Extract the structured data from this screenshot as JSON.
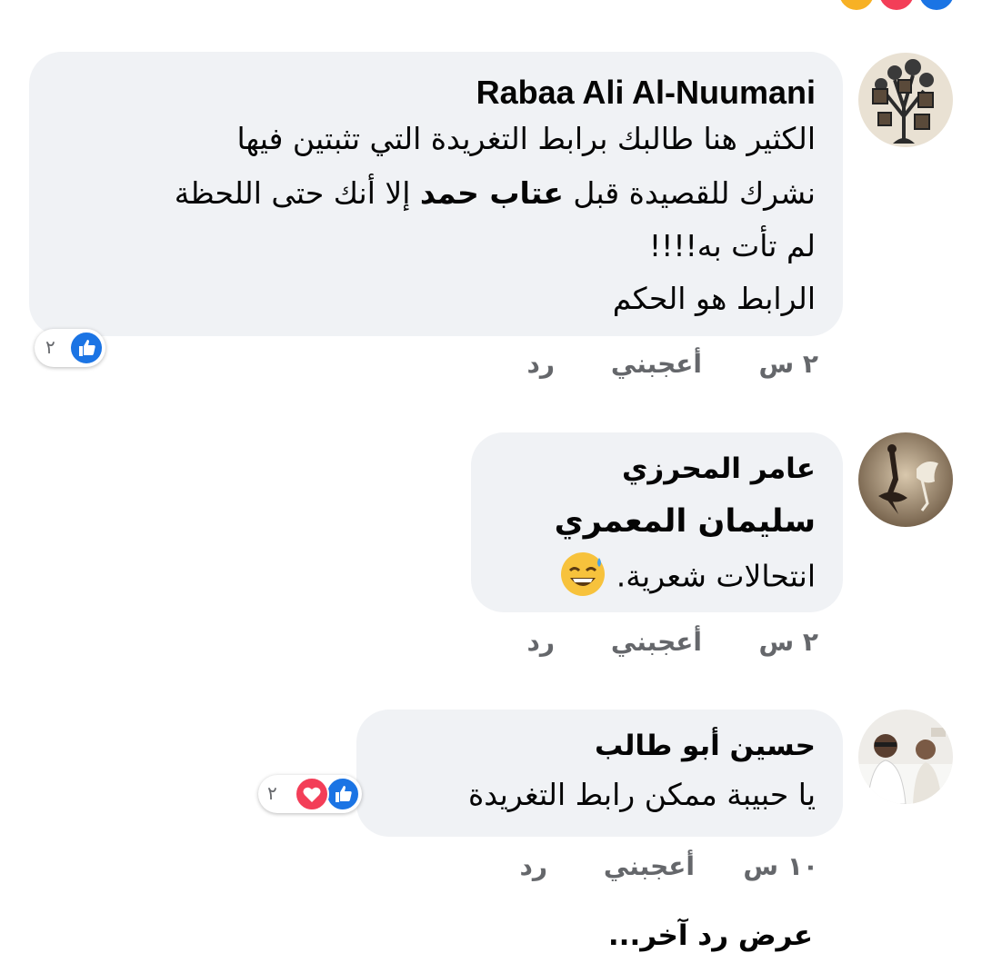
{
  "comments": [
    {
      "author": "Rabaa Ali Al-Nuumani",
      "lines": [
        "الكثير هنا طالبك برابط التغريدة التي تثبتين فيها",
        "لم تأت به!!!!",
        "الرابط هو الحكم"
      ],
      "line2_before": "نشرك للقصيدة قبل ",
      "line2_mention": "عتاب حمد",
      "line2_after": " إلا أنك حتى اللحظة",
      "time": "٢ س",
      "like_label": "أعجبني",
      "reply_label": "رد",
      "reaction_count": "٢",
      "reactions": [
        "like-icon"
      ]
    },
    {
      "author": "عامر المحرزي",
      "mention": "سليمان المعمري",
      "text": "انتحالات شعرية.",
      "emoji": "😅",
      "time": "٢ س",
      "like_label": "أعجبني",
      "reply_label": "رد"
    },
    {
      "author": "حسين أبو طالب",
      "text": "يا حبيبة ممكن رابط التغريدة",
      "time": "١٠ س",
      "like_label": "أعجبني",
      "reply_label": "رد",
      "reaction_count": "٢",
      "reactions": [
        "like-icon",
        "love-icon"
      ]
    }
  ],
  "more_replies_label": "عرض رد آخر...",
  "colors": {
    "bubble": "#f0f2f5",
    "muted_text": "#65676b",
    "like_blue": "#1b74e4",
    "love_red": "#f33e58"
  }
}
